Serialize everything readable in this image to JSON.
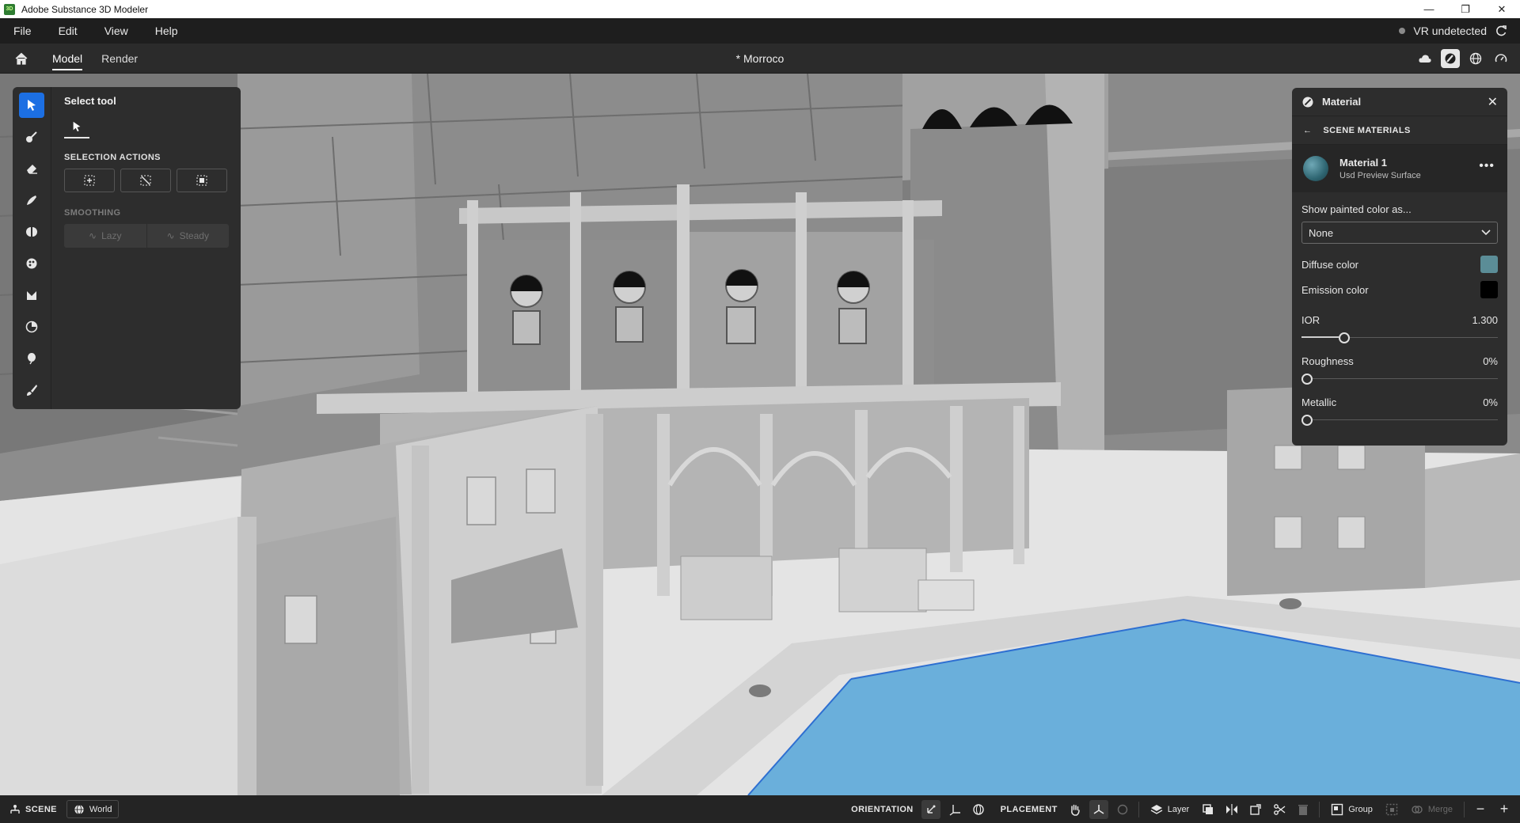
{
  "window": {
    "title": "Adobe Substance 3D Modeler",
    "controls": [
      "minimize",
      "restore",
      "close"
    ]
  },
  "menu": {
    "items": [
      "File",
      "Edit",
      "View",
      "Help"
    ],
    "vr_status": "VR undetected"
  },
  "tabs": {
    "items": [
      {
        "label": "Model",
        "active": true
      },
      {
        "label": "Render",
        "active": false
      }
    ],
    "document_title": "*  Morroco",
    "right_icons": [
      "scene-cloud-icon",
      "material-brush-icon",
      "globe-icon",
      "gauge-icon"
    ]
  },
  "left_toolbar": {
    "tools": [
      "select-arrow-icon",
      "clay-brush-icon",
      "eraser-icon",
      "smooth-brush-icon",
      "symmetry-icon",
      "paint-palette-icon",
      "stamp-icon",
      "sphere-primitive-icon",
      "balloon-icon",
      "paint-brush-icon"
    ],
    "active_index": 0
  },
  "tool_panel": {
    "title": "Select tool",
    "selection_actions_label": "SELECTION ACTIONS",
    "smoothing_label": "SMOOTHING",
    "smoothing_options": [
      "Lazy",
      "Steady"
    ]
  },
  "material_panel": {
    "title": "Material",
    "breadcrumb": "SCENE MATERIALS",
    "material_name": "Material 1",
    "material_type": "Usd Preview Surface",
    "show_painted_label": "Show painted color as...",
    "show_painted_value": "None",
    "diffuse_label": "Diffuse color",
    "diffuse_color": "#5b8d97",
    "emission_label": "Emission color",
    "emission_color": "#000000",
    "ior_label": "IOR",
    "ior_value": "1.300",
    "ior_fraction": 0.2,
    "roughness_label": "Roughness",
    "roughness_value": "0%",
    "roughness_fraction": 0,
    "metallic_label": "Metallic",
    "metallic_value": "0%",
    "metallic_fraction": 0
  },
  "bottom_bar": {
    "scene_label": "SCENE",
    "world_label": "World",
    "orientation_label": "ORIENTATION",
    "placement_label": "PLACEMENT",
    "layer_label": "Layer",
    "group_label": "Group",
    "merge_label": "Merge"
  },
  "colors": {
    "accent": "#1c6fe3",
    "water": "#6aafdb",
    "panel": "#2d2d2d"
  }
}
